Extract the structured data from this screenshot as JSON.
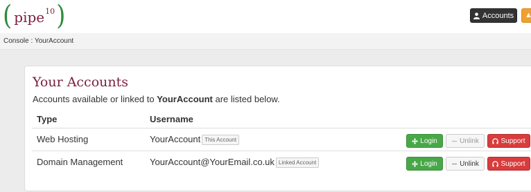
{
  "logo": {
    "left_paren": "(",
    "word": "pipe",
    "sup": "10",
    "right_paren": ")"
  },
  "header": {
    "accounts_label": "Accounts"
  },
  "breadcrumb": "Console : YourAccount",
  "panel": {
    "title": "Your Accounts",
    "desc_prefix": "Accounts available or linked to ",
    "desc_account": "YourAccount",
    "desc_suffix": " are listed below.",
    "columns": {
      "type": "Type",
      "username": "Username"
    }
  },
  "rows": [
    {
      "type": "Web Hosting",
      "username": "YourAccount",
      "tag": "This Account",
      "login": "Login",
      "unlink": "Unlink",
      "support": "Support"
    },
    {
      "type": "Domain Management",
      "username": "YourAccount@YourEmail.co.uk",
      "tag": "Linked Account",
      "login": "Login",
      "unlink": "Unlink",
      "support": "Support"
    }
  ],
  "colors": {
    "brand_red": "#7a1f3a",
    "brand_green": "#2e8b3d",
    "login_green": "#48a848",
    "support_red": "#d83c3c"
  },
  "icons": {
    "accounts": "user-icon",
    "login": "move-icon",
    "unlink": "minus-icon",
    "support": "headphones-icon"
  }
}
